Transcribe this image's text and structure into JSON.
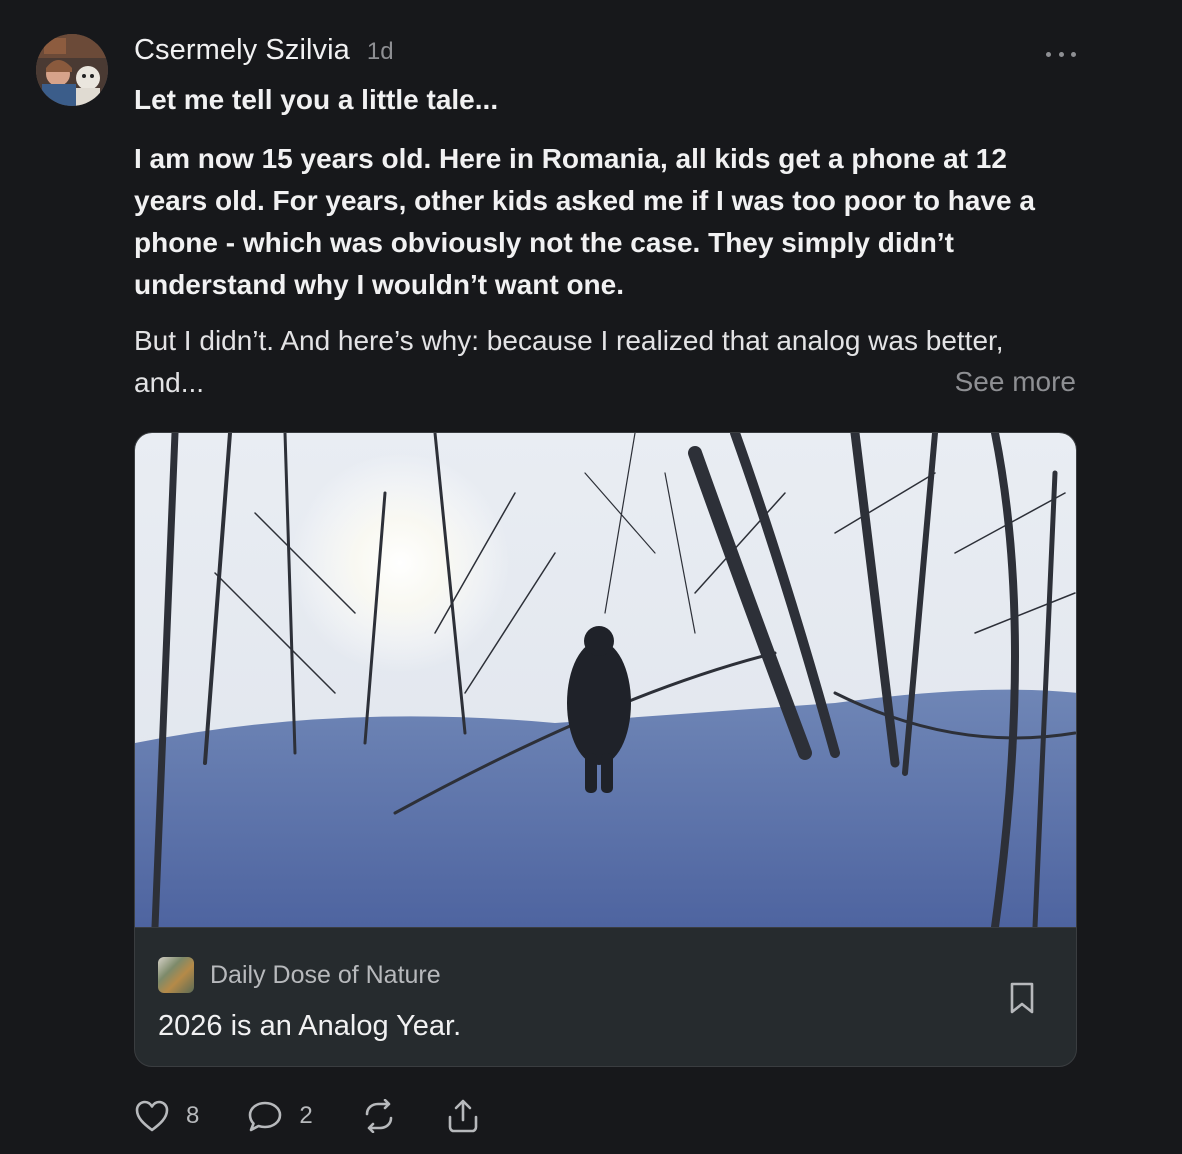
{
  "post": {
    "author": "Csermely Szilvia",
    "time": "1d",
    "title": "Let me tell you a little tale...",
    "bold_paragraph": "I am now 15 years old. Here in Romania, all kids get a phone at 12 years old. For years, other kids asked me if I was too poor to have a phone - which was obviously not the case. They simply didn’t understand why I wouldn’t want one.",
    "paragraph": "But I didn’t. And here’s why: because I realized that analog was better, and...",
    "see_more": "See more"
  },
  "card": {
    "publication": "Daily Dose of Nature",
    "title": "2026 is an Analog Year."
  },
  "actions": {
    "likes": "8",
    "comments": "2"
  },
  "icons": [
    "more-icon",
    "bookmark-icon",
    "heart-icon",
    "comment-icon",
    "restack-icon",
    "share-icon"
  ]
}
